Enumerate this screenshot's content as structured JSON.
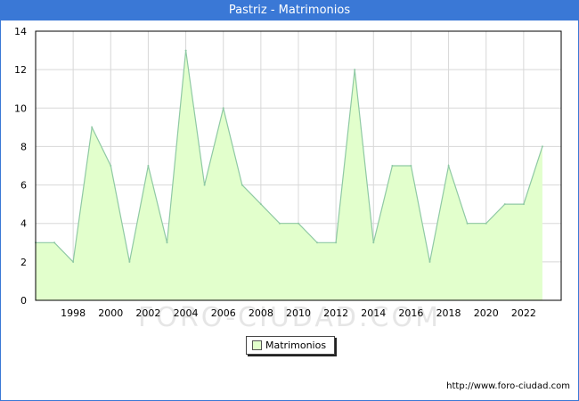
{
  "header": {
    "title": "Pastriz - Matrimonios"
  },
  "watermark": "FORO-CIUDAD.COM",
  "legend": {
    "label": "Matrimonios"
  },
  "footer": {
    "url": "http://www.foro-ciudad.com"
  },
  "colors": {
    "accent": "#3a78d6",
    "area_fill": "#e2ffcc",
    "line": "#8fc9a4",
    "grid": "#d8d8d8"
  },
  "chart_data": {
    "type": "area",
    "title": "Pastriz - Matrimonios",
    "xlabel": "",
    "ylabel": "",
    "xlim": [
      1996,
      2024
    ],
    "ylim": [
      0,
      14
    ],
    "x_ticks": [
      1998,
      2000,
      2002,
      2004,
      2006,
      2008,
      2010,
      2012,
      2014,
      2016,
      2018,
      2020,
      2022
    ],
    "y_ticks": [
      0,
      2,
      4,
      6,
      8,
      10,
      12,
      14
    ],
    "grid": true,
    "legend_position": "bottom-center",
    "series": [
      {
        "name": "Matrimonios",
        "x": [
          1996,
          1997,
          1998,
          1999,
          2000,
          2001,
          2002,
          2003,
          2004,
          2005,
          2006,
          2007,
          2008,
          2009,
          2010,
          2011,
          2012,
          2013,
          2014,
          2015,
          2016,
          2017,
          2018,
          2019,
          2020,
          2021,
          2022,
          2023
        ],
        "values": [
          3,
          3,
          2,
          9,
          7,
          2,
          7,
          3,
          13,
          6,
          10,
          6,
          5,
          4,
          4,
          3,
          3,
          12,
          3,
          7,
          7,
          2,
          7,
          4,
          4,
          5,
          5,
          8
        ]
      }
    ]
  }
}
